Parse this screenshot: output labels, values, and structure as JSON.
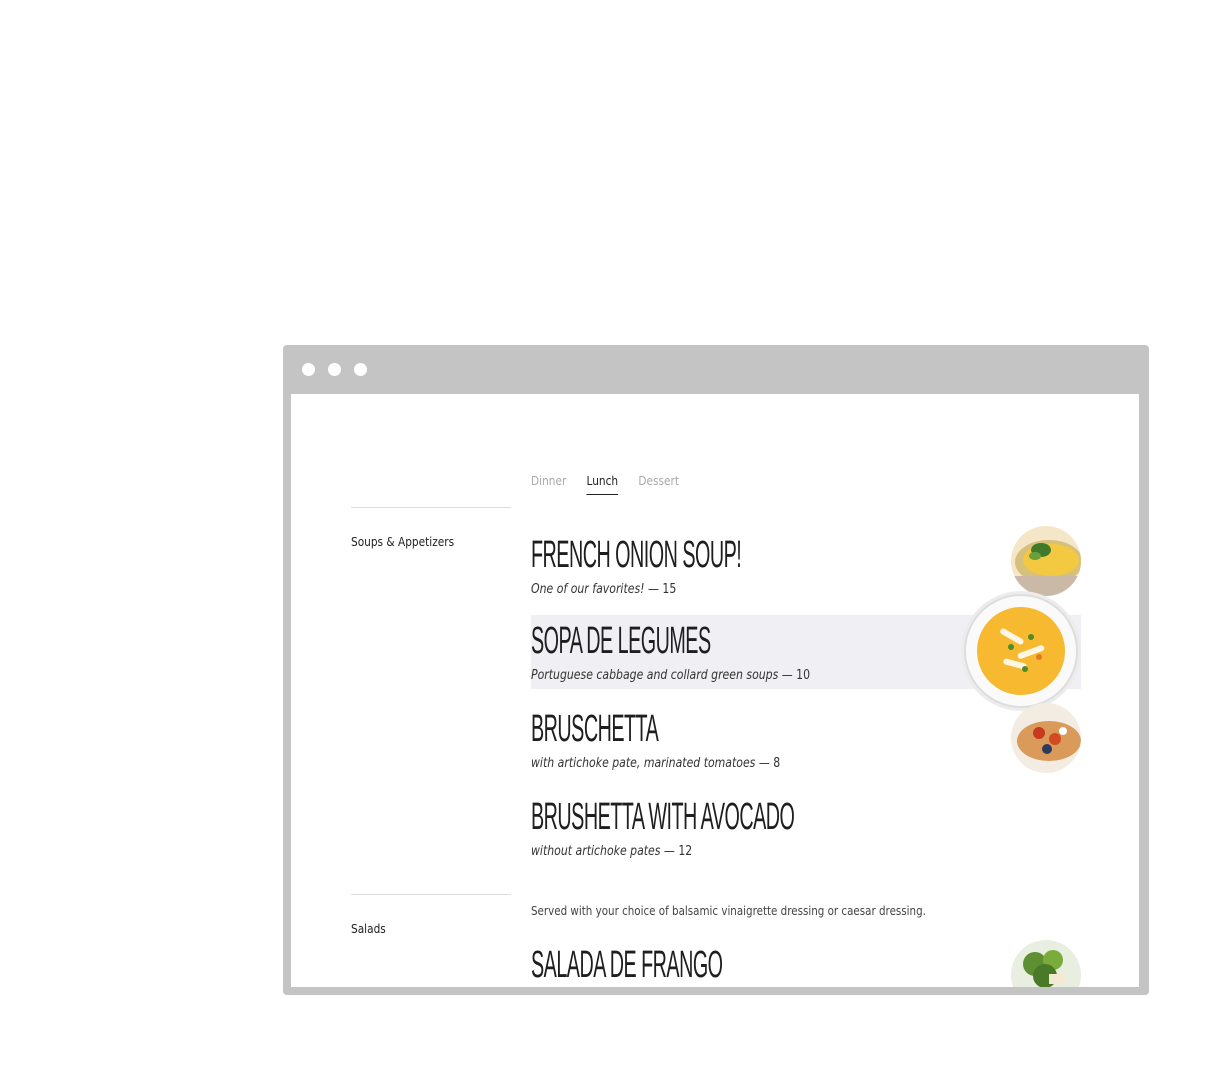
{
  "window": {
    "controls": [
      "close-dot",
      "minimize-dot",
      "maximize-dot"
    ]
  },
  "tabs": [
    {
      "label": "Dinner",
      "active": false
    },
    {
      "label": "Lunch",
      "active": true
    },
    {
      "label": "Dessert",
      "active": false
    }
  ],
  "categories": [
    {
      "label": "Soups & Appetizers"
    },
    {
      "label": "Salads",
      "note": "Served with your choice of balsamic vinaigrette dressing or caesar dressing."
    }
  ],
  "items": [
    {
      "name": "French Onion Soup!",
      "desc": "One of our favorites!",
      "price": "— 15",
      "image": "onion-soup-photo"
    },
    {
      "name": "Sopa de Legumes",
      "desc": "Portuguese cabbage and collard green soups",
      "price": "— 10",
      "image": "vegetable-soup-photo",
      "hovered": true
    },
    {
      "name": "Bruschetta",
      "desc": "with artichoke pate, marinated tomatoes",
      "price": "— 8",
      "image": "bruschetta-photo"
    },
    {
      "name": "Brushetta with Avocado",
      "desc": "without artichoke pates",
      "price": "— 12"
    },
    {
      "name": "Salada de Frango",
      "image": "chicken-salad-photo"
    }
  ],
  "colors": {
    "chrome": "#c4c4c4",
    "highlight": "#f0f0f4",
    "text": "#1e1e1e",
    "muted": "#a9a9a9"
  }
}
